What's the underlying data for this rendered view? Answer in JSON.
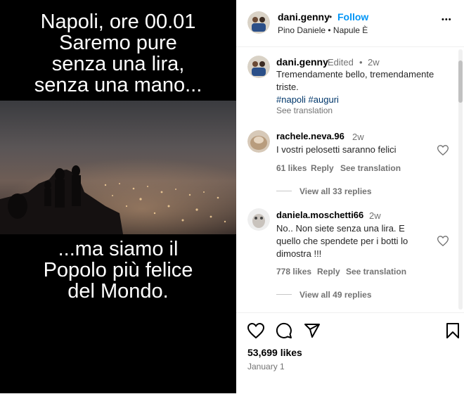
{
  "media": {
    "caption_top": [
      "Napoli, ore 00.01",
      "Saremo pure",
      "senza una lira,",
      "senza una mano..."
    ],
    "caption_bottom": [
      "...ma siamo il",
      "Popolo più felice",
      "del Mondo."
    ]
  },
  "header": {
    "username": "dani.genny",
    "separator": "•",
    "follow_label": "Follow",
    "subtitle": "Pino Daniele • Napule È",
    "more": "•••"
  },
  "post": {
    "username": "dani.genny",
    "edited": "Edited",
    "dot": "•",
    "time": "2w",
    "text_line1": "Tremendamente bello, tremendamente",
    "text_line2": "triste.",
    "hashtags": "#napoli #auguri",
    "see_translation": "See translation"
  },
  "comments": [
    {
      "username": "rachele.neva.96",
      "time": "2w",
      "text": [
        "I vostri pelosetti saranno felici"
      ],
      "likes": "61 likes",
      "reply": "Reply",
      "see_translation": "See translation",
      "view_replies": "View all 33 replies"
    },
    {
      "username": "daniela.moschetti66",
      "time": "2w",
      "text": [
        "No.. Non siete senza una lira. E",
        "quello che spendete per i botti lo",
        "dimostra !!!"
      ],
      "likes": "778 likes",
      "reply": "Reply",
      "see_translation": "See translation",
      "view_replies": "View all 49 replies"
    }
  ],
  "footer": {
    "likes": "53,699 likes",
    "date": "January 1"
  },
  "colors": {
    "follow": "#0095f6",
    "hashtag": "#00376b",
    "muted": "#737373"
  }
}
